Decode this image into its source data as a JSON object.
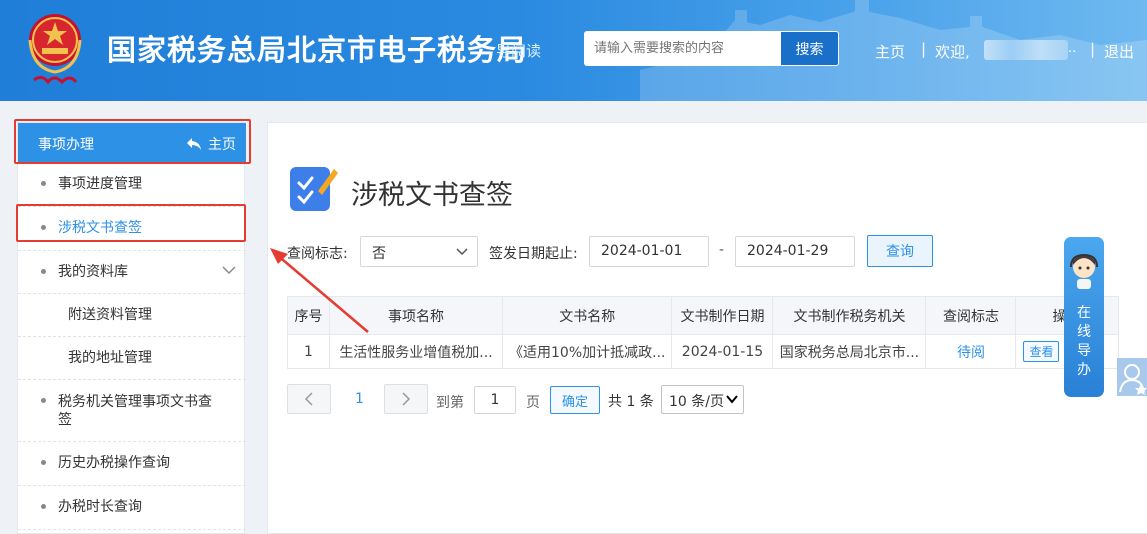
{
  "header": {
    "site_title": "国家税务总局北京市电子税务局",
    "read_link": "导阅读",
    "search_placeholder": "请输入需要搜索的内容",
    "search_button": "搜索",
    "nav_home": "主页",
    "separator": "|",
    "welcome": "欢迎,",
    "ellipsis": "..",
    "logout": "退出"
  },
  "sidebar": {
    "title": "事项办理",
    "home_label": "主页",
    "items": [
      {
        "label": "事项进度管理"
      },
      {
        "label": "涉税文书查签"
      },
      {
        "label": "我的资料库"
      },
      {
        "label": "附送资料管理"
      },
      {
        "label": "我的地址管理"
      },
      {
        "label": "税务机关管理事项文书查签"
      },
      {
        "label": "历史办税操作查询"
      },
      {
        "label": "办税时长查询"
      }
    ]
  },
  "main": {
    "page_title": "涉税文书查签",
    "filter": {
      "read_flag_label": "查阅标志:",
      "read_flag_value": "否",
      "date_range_label": "签发日期起止:",
      "date_start": "2024-01-01",
      "date_dash": "-",
      "date_end": "2024-01-29",
      "query_button": "查询"
    },
    "table": {
      "headers": [
        "序号",
        "事项名称",
        "文书名称",
        "文书制作日期",
        "文书制作税务机关",
        "查阅标志",
        "操作"
      ],
      "rows": [
        {
          "index": "1",
          "item_name": "生活性服务业增值税加...",
          "doc_name": "《适用10%加计抵减政...",
          "date": "2024-01-15",
          "office": "国家税务总局北京市...",
          "status": "待阅",
          "action": "查看"
        }
      ]
    },
    "pagination": {
      "current_page": "1",
      "goto_label": "到第",
      "goto_value": "1",
      "page_unit": "页",
      "confirm": "确定",
      "total": "共 1 条",
      "page_size": "10 条/页"
    }
  },
  "guide": {
    "label_lines": [
      "在",
      "线",
      "导",
      "办"
    ]
  },
  "colors": {
    "header_blue": "#1f7ed8",
    "accent": "#2d91e6",
    "highlight_red": "#e53b30"
  }
}
